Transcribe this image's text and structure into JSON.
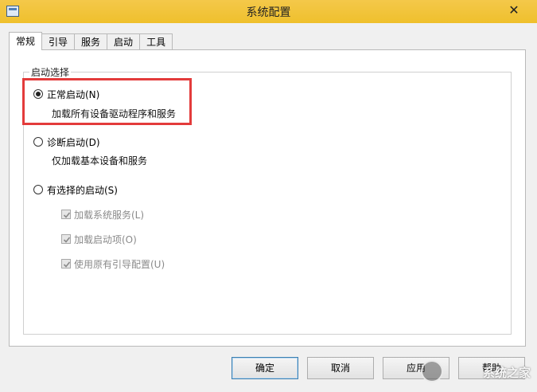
{
  "window": {
    "title": "系统配置"
  },
  "tabs": [
    {
      "label": "常规",
      "active": true
    },
    {
      "label": "引导",
      "active": false
    },
    {
      "label": "服务",
      "active": false
    },
    {
      "label": "启动",
      "active": false
    },
    {
      "label": "工具",
      "active": false
    }
  ],
  "startup": {
    "group_title": "启动选择",
    "normal": {
      "label": "正常启动(N)",
      "desc": "加载所有设备驱动程序和服务",
      "checked": true
    },
    "diagnostic": {
      "label": "诊断启动(D)",
      "desc": "仅加载基本设备和服务",
      "checked": false
    },
    "selective": {
      "label": "有选择的启动(S)",
      "checked": false,
      "options": [
        {
          "label": "加载系统服务(L)",
          "checked": true,
          "enabled": false
        },
        {
          "label": "加载启动项(O)",
          "checked": true,
          "enabled": false
        },
        {
          "label": "使用原有引导配置(U)",
          "checked": true,
          "enabled": false
        }
      ]
    }
  },
  "buttons": {
    "ok": "确定",
    "cancel": "取消",
    "apply": "应用",
    "help": "帮助"
  },
  "watermark": {
    "text": "系统之家"
  },
  "colors": {
    "titlebar": "#f1c232",
    "highlight": "#e33b3b"
  },
  "icons": {
    "app": "window-icon",
    "close": "close-icon",
    "checkbox": "checkmark-icon"
  }
}
